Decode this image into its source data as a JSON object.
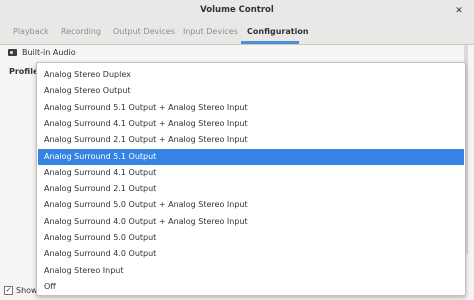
{
  "window": {
    "title": "Volume Control",
    "close_glyph": "✕"
  },
  "tabs": [
    {
      "label": "Playback"
    },
    {
      "label": "Recording"
    },
    {
      "label": "Output Devices"
    },
    {
      "label": "Input Devices"
    },
    {
      "label": "Configuration"
    }
  ],
  "active_tab": "Configuration",
  "card": {
    "name": "Built-in Audio",
    "icon": "sound-card-icon"
  },
  "profile": {
    "label": "Profile:",
    "selected": "Analog Surround 5.1 Output",
    "options": [
      "Analog Stereo Duplex",
      "Analog Stereo Output",
      "Analog Surround 5.1 Output + Analog Stereo Input",
      "Analog Surround 4.1 Output + Analog Stereo Input",
      "Analog Surround 2.1 Output + Analog Stereo Input",
      "Analog Surround 5.1 Output",
      "Analog Surround 4.1 Output",
      "Analog Surround 2.1 Output",
      "Analog Surround 5.0 Output + Analog Stereo Input",
      "Analog Surround 4.0 Output + Analog Stereo Input",
      "Analog Surround 5.0 Output",
      "Analog Surround 4.0 Output",
      "Analog Stereo Input",
      "Off"
    ]
  },
  "footer": {
    "show_label": "Show",
    "checked": true,
    "check_glyph": "✓"
  },
  "colors": {
    "accent": "#3584e4",
    "tab_underline": "#4a90d9"
  }
}
